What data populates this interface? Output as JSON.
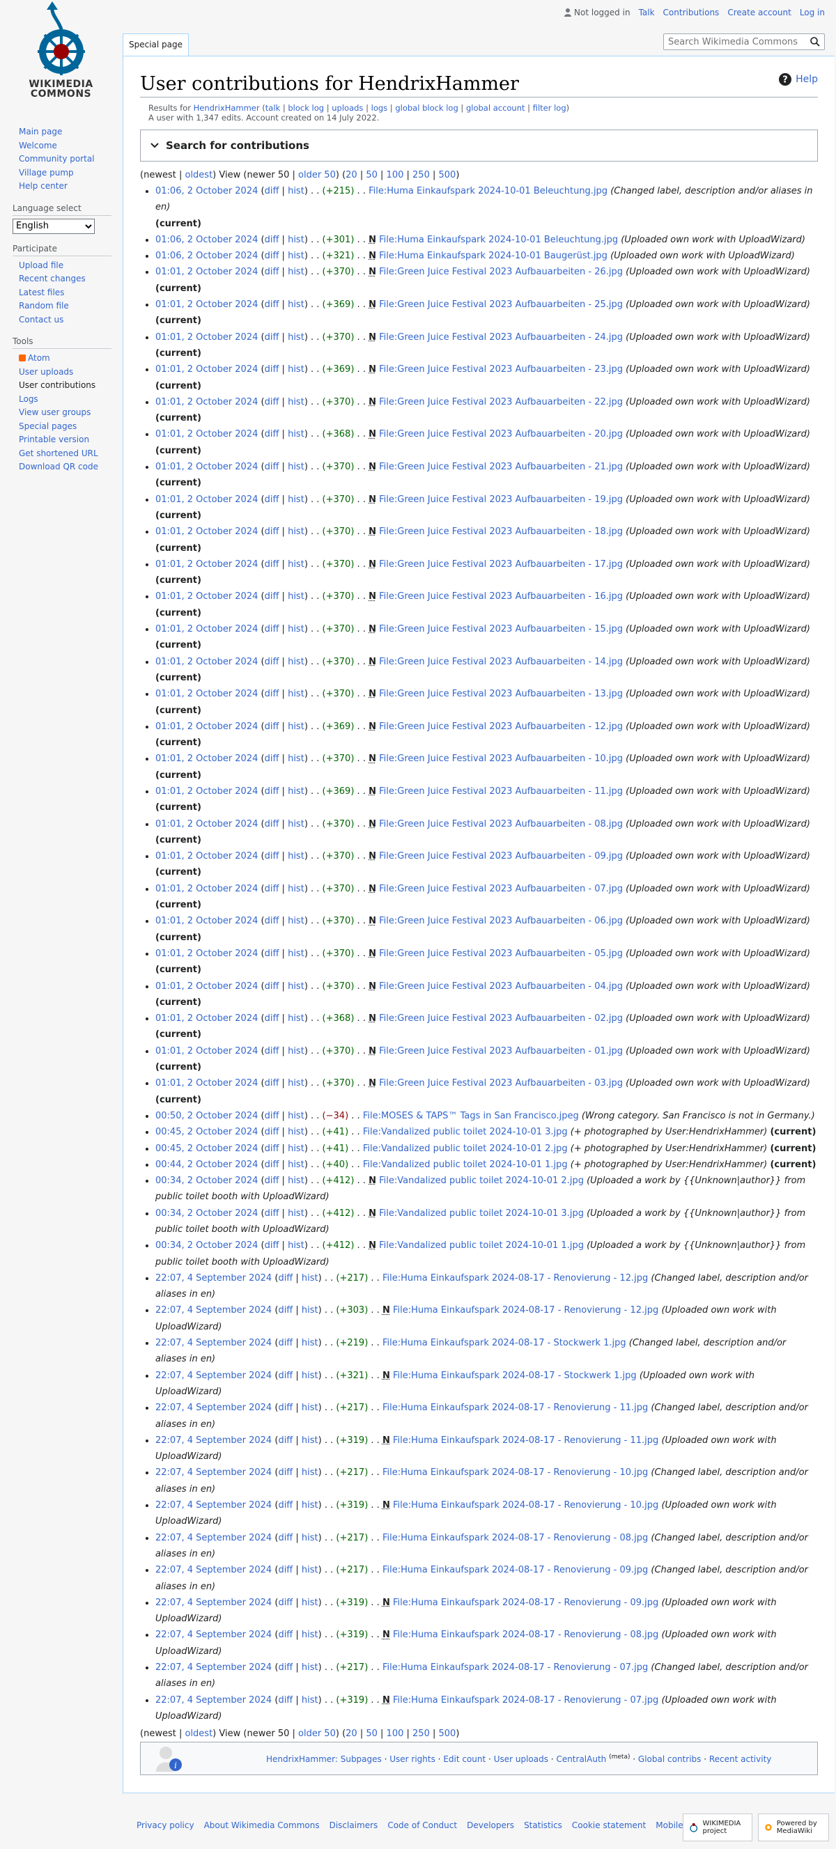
{
  "header": {
    "logo_alt": "Wikimedia Commons",
    "logo_line1": "WIKIMEDIA",
    "logo_line2": "COMMONS",
    "not_logged_in": "Not logged in",
    "talk": "Talk",
    "contributions": "Contributions",
    "create_account": "Create account",
    "log_in": "Log in",
    "tab_label": "Special page",
    "search_placeholder": "Search Wikimedia Commons"
  },
  "sidebar": {
    "nav": [
      "Main page",
      "Welcome",
      "Community portal",
      "Village pump",
      "Help center"
    ],
    "language_heading": "Language select",
    "language_value": "English",
    "participate_heading": "Participate",
    "participate": [
      "Upload file",
      "Recent changes",
      "Latest files",
      "Random file",
      "Contact us"
    ],
    "tools_heading": "Tools",
    "atom": "Atom",
    "tools": [
      "User uploads",
      "User contributions",
      "Logs",
      "View user groups",
      "Special pages",
      "Printable version",
      "Get shortened URL",
      "Download QR code"
    ]
  },
  "page": {
    "title": "User contributions for HendrixHammer",
    "help": "Help",
    "results_prefix": "Results for ",
    "user": "HendrixHammer",
    "user_links": [
      "talk",
      "block log",
      "uploads",
      "logs",
      "global block log",
      "global account",
      "filter log"
    ],
    "edit_info": "A user with 1,347 edits. Account created on 14 July 2022.",
    "search_toggle": "Search for contributions",
    "nav_newest": "newest",
    "nav_oldest": "oldest",
    "nav_view": "View",
    "nav_newer": "newer 50",
    "nav_older": "older 50",
    "nav_limits": [
      "20",
      "50",
      "100",
      "250",
      "500"
    ]
  },
  "contribs": [
    {
      "time": "01:06, 2 October 2024",
      "diff": "+215",
      "new": false,
      "title": "File:Huma Einkaufspark 2024-10-01 Beleuchtung.jpg",
      "comment": "(Changed label, description and/or aliases in en)",
      "current": true
    },
    {
      "time": "01:06, 2 October 2024",
      "diff": "+301",
      "new": true,
      "title": "File:Huma Einkaufspark 2024-10-01 Beleuchtung.jpg",
      "comment": "(Uploaded own work with UploadWizard)",
      "current": false
    },
    {
      "time": "01:06, 2 October 2024",
      "diff": "+321",
      "new": true,
      "title": "File:Huma Einkaufspark 2024-10-01 Baugerüst.jpg",
      "comment": "(Uploaded own work with UploadWizard)",
      "current": false
    },
    {
      "time": "01:01, 2 October 2024",
      "diff": "+370",
      "new": true,
      "title": "File:Green Juice Festival 2023 Aufbauarbeiten - 26.jpg",
      "comment": "(Uploaded own work with UploadWizard)",
      "current": true
    },
    {
      "time": "01:01, 2 October 2024",
      "diff": "+369",
      "new": true,
      "title": "File:Green Juice Festival 2023 Aufbauarbeiten - 25.jpg",
      "comment": "(Uploaded own work with UploadWizard)",
      "current": true
    },
    {
      "time": "01:01, 2 October 2024",
      "diff": "+370",
      "new": true,
      "title": "File:Green Juice Festival 2023 Aufbauarbeiten - 24.jpg",
      "comment": "(Uploaded own work with UploadWizard)",
      "current": true
    },
    {
      "time": "01:01, 2 October 2024",
      "diff": "+369",
      "new": true,
      "title": "File:Green Juice Festival 2023 Aufbauarbeiten - 23.jpg",
      "comment": "(Uploaded own work with UploadWizard)",
      "current": true
    },
    {
      "time": "01:01, 2 October 2024",
      "diff": "+370",
      "new": true,
      "title": "File:Green Juice Festival 2023 Aufbauarbeiten - 22.jpg",
      "comment": "(Uploaded own work with UploadWizard)",
      "current": true
    },
    {
      "time": "01:01, 2 October 2024",
      "diff": "+368",
      "new": true,
      "title": "File:Green Juice Festival 2023 Aufbauarbeiten - 20.jpg",
      "comment": "(Uploaded own work with UploadWizard)",
      "current": true
    },
    {
      "time": "01:01, 2 October 2024",
      "diff": "+370",
      "new": true,
      "title": "File:Green Juice Festival 2023 Aufbauarbeiten - 21.jpg",
      "comment": "(Uploaded own work with UploadWizard)",
      "current": true
    },
    {
      "time": "01:01, 2 October 2024",
      "diff": "+370",
      "new": true,
      "title": "File:Green Juice Festival 2023 Aufbauarbeiten - 19.jpg",
      "comment": "(Uploaded own work with UploadWizard)",
      "current": true
    },
    {
      "time": "01:01, 2 October 2024",
      "diff": "+370",
      "new": true,
      "title": "File:Green Juice Festival 2023 Aufbauarbeiten - 18.jpg",
      "comment": "(Uploaded own work with UploadWizard)",
      "current": true
    },
    {
      "time": "01:01, 2 October 2024",
      "diff": "+370",
      "new": true,
      "title": "File:Green Juice Festival 2023 Aufbauarbeiten - 17.jpg",
      "comment": "(Uploaded own work with UploadWizard)",
      "current": true
    },
    {
      "time": "01:01, 2 October 2024",
      "diff": "+370",
      "new": true,
      "title": "File:Green Juice Festival 2023 Aufbauarbeiten - 16.jpg",
      "comment": "(Uploaded own work with UploadWizard)",
      "current": true
    },
    {
      "time": "01:01, 2 October 2024",
      "diff": "+370",
      "new": true,
      "title": "File:Green Juice Festival 2023 Aufbauarbeiten - 15.jpg",
      "comment": "(Uploaded own work with UploadWizard)",
      "current": true
    },
    {
      "time": "01:01, 2 October 2024",
      "diff": "+370",
      "new": true,
      "title": "File:Green Juice Festival 2023 Aufbauarbeiten - 14.jpg",
      "comment": "(Uploaded own work with UploadWizard)",
      "current": true
    },
    {
      "time": "01:01, 2 October 2024",
      "diff": "+370",
      "new": true,
      "title": "File:Green Juice Festival 2023 Aufbauarbeiten - 13.jpg",
      "comment": "(Uploaded own work with UploadWizard)",
      "current": true
    },
    {
      "time": "01:01, 2 October 2024",
      "diff": "+369",
      "new": true,
      "title": "File:Green Juice Festival 2023 Aufbauarbeiten - 12.jpg",
      "comment": "(Uploaded own work with UploadWizard)",
      "current": true
    },
    {
      "time": "01:01, 2 October 2024",
      "diff": "+370",
      "new": true,
      "title": "File:Green Juice Festival 2023 Aufbauarbeiten - 10.jpg",
      "comment": "(Uploaded own work with UploadWizard)",
      "current": true
    },
    {
      "time": "01:01, 2 October 2024",
      "diff": "+369",
      "new": true,
      "title": "File:Green Juice Festival 2023 Aufbauarbeiten - 11.jpg",
      "comment": "(Uploaded own work with UploadWizard)",
      "current": true
    },
    {
      "time": "01:01, 2 October 2024",
      "diff": "+370",
      "new": true,
      "title": "File:Green Juice Festival 2023 Aufbauarbeiten - 08.jpg",
      "comment": "(Uploaded own work with UploadWizard)",
      "current": true
    },
    {
      "time": "01:01, 2 October 2024",
      "diff": "+370",
      "new": true,
      "title": "File:Green Juice Festival 2023 Aufbauarbeiten - 09.jpg",
      "comment": "(Uploaded own work with UploadWizard)",
      "current": true
    },
    {
      "time": "01:01, 2 October 2024",
      "diff": "+370",
      "new": true,
      "title": "File:Green Juice Festival 2023 Aufbauarbeiten - 07.jpg",
      "comment": "(Uploaded own work with UploadWizard)",
      "current": true
    },
    {
      "time": "01:01, 2 October 2024",
      "diff": "+370",
      "new": true,
      "title": "File:Green Juice Festival 2023 Aufbauarbeiten - 06.jpg",
      "comment": "(Uploaded own work with UploadWizard)",
      "current": true
    },
    {
      "time": "01:01, 2 October 2024",
      "diff": "+370",
      "new": true,
      "title": "File:Green Juice Festival 2023 Aufbauarbeiten - 05.jpg",
      "comment": "(Uploaded own work with UploadWizard)",
      "current": true
    },
    {
      "time": "01:01, 2 October 2024",
      "diff": "+370",
      "new": true,
      "title": "File:Green Juice Festival 2023 Aufbauarbeiten - 04.jpg",
      "comment": "(Uploaded own work with UploadWizard)",
      "current": true
    },
    {
      "time": "01:01, 2 October 2024",
      "diff": "+368",
      "new": true,
      "title": "File:Green Juice Festival 2023 Aufbauarbeiten - 02.jpg",
      "comment": "(Uploaded own work with UploadWizard)",
      "current": true
    },
    {
      "time": "01:01, 2 October 2024",
      "diff": "+370",
      "new": true,
      "title": "File:Green Juice Festival 2023 Aufbauarbeiten - 01.jpg",
      "comment": "(Uploaded own work with UploadWizard)",
      "current": true
    },
    {
      "time": "01:01, 2 October 2024",
      "diff": "+370",
      "new": true,
      "title": "File:Green Juice Festival 2023 Aufbauarbeiten - 03.jpg",
      "comment": "(Uploaded own work with UploadWizard)",
      "current": true
    },
    {
      "time": "00:50, 2 October 2024",
      "diff": "−34",
      "new": false,
      "title": "File:MOSES & TAPS™ Tags in San Francisco.jpeg",
      "comment": "(Wrong category. San Francisco is not in Germany.)",
      "current": false
    },
    {
      "time": "00:45, 2 October 2024",
      "diff": "+41",
      "new": false,
      "title": "File:Vandalized public toilet 2024-10-01 3.jpg",
      "comment": "(+ photographed by User:HendrixHammer)",
      "current": true
    },
    {
      "time": "00:45, 2 October 2024",
      "diff": "+41",
      "new": false,
      "title": "File:Vandalized public toilet 2024-10-01 2.jpg",
      "comment": "(+ photographed by User:HendrixHammer)",
      "current": true
    },
    {
      "time": "00:44, 2 October 2024",
      "diff": "+40",
      "new": false,
      "title": "File:Vandalized public toilet 2024-10-01 1.jpg",
      "comment": "(+ photographed by User:HendrixHammer)",
      "current": true
    },
    {
      "time": "00:34, 2 October 2024",
      "diff": "+412",
      "new": true,
      "title": "File:Vandalized public toilet 2024-10-01 2.jpg",
      "comment": "(Uploaded a work by {{Unknown|author}} from public toilet booth with UploadWizard)",
      "current": false
    },
    {
      "time": "00:34, 2 October 2024",
      "diff": "+412",
      "new": true,
      "title": "File:Vandalized public toilet 2024-10-01 3.jpg",
      "comment": "(Uploaded a work by {{Unknown|author}} from public toilet booth with UploadWizard)",
      "current": false
    },
    {
      "time": "00:34, 2 October 2024",
      "diff": "+412",
      "new": true,
      "title": "File:Vandalized public toilet 2024-10-01 1.jpg",
      "comment": "(Uploaded a work by {{Unknown|author}} from public toilet booth with UploadWizard)",
      "current": false
    },
    {
      "time": "22:07, 4 September 2024",
      "diff": "+217",
      "new": false,
      "title": "File:Huma Einkaufspark 2024-08-17 - Renovierung - 12.jpg",
      "comment": "(Changed label, description and/or aliases in en)",
      "current": false
    },
    {
      "time": "22:07, 4 September 2024",
      "diff": "+303",
      "new": true,
      "title": "File:Huma Einkaufspark 2024-08-17 - Renovierung - 12.jpg",
      "comment": "(Uploaded own work with UploadWizard)",
      "current": false
    },
    {
      "time": "22:07, 4 September 2024",
      "diff": "+219",
      "new": false,
      "title": "File:Huma Einkaufspark 2024-08-17 - Stockwerk 1.jpg",
      "comment": "(Changed label, description and/or aliases in en)",
      "current": false
    },
    {
      "time": "22:07, 4 September 2024",
      "diff": "+321",
      "new": true,
      "title": "File:Huma Einkaufspark 2024-08-17 - Stockwerk 1.jpg",
      "comment": "(Uploaded own work with UploadWizard)",
      "current": false
    },
    {
      "time": "22:07, 4 September 2024",
      "diff": "+217",
      "new": false,
      "title": "File:Huma Einkaufspark 2024-08-17 - Renovierung - 11.jpg",
      "comment": "(Changed label, description and/or aliases in en)",
      "current": false
    },
    {
      "time": "22:07, 4 September 2024",
      "diff": "+319",
      "new": true,
      "title": "File:Huma Einkaufspark 2024-08-17 - Renovierung - 11.jpg",
      "comment": "(Uploaded own work with UploadWizard)",
      "current": false
    },
    {
      "time": "22:07, 4 September 2024",
      "diff": "+217",
      "new": false,
      "title": "File:Huma Einkaufspark 2024-08-17 - Renovierung - 10.jpg",
      "comment": "(Changed label, description and/or aliases in en)",
      "current": false
    },
    {
      "time": "22:07, 4 September 2024",
      "diff": "+319",
      "new": true,
      "title": "File:Huma Einkaufspark 2024-08-17 - Renovierung - 10.jpg",
      "comment": "(Uploaded own work with UploadWizard)",
      "current": false
    },
    {
      "time": "22:07, 4 September 2024",
      "diff": "+217",
      "new": false,
      "title": "File:Huma Einkaufspark 2024-08-17 - Renovierung - 08.jpg",
      "comment": "(Changed label, description and/or aliases in en)",
      "current": false
    },
    {
      "time": "22:07, 4 September 2024",
      "diff": "+217",
      "new": false,
      "title": "File:Huma Einkaufspark 2024-08-17 - Renovierung - 09.jpg",
      "comment": "(Changed label, description and/or aliases in en)",
      "current": false
    },
    {
      "time": "22:07, 4 September 2024",
      "diff": "+319",
      "new": true,
      "title": "File:Huma Einkaufspark 2024-08-17 - Renovierung - 09.jpg",
      "comment": "(Uploaded own work with UploadWizard)",
      "current": false
    },
    {
      "time": "22:07, 4 September 2024",
      "diff": "+319",
      "new": true,
      "title": "File:Huma Einkaufspark 2024-08-17 - Renovierung - 08.jpg",
      "comment": "(Uploaded own work with UploadWizard)",
      "current": false
    },
    {
      "time": "22:07, 4 September 2024",
      "diff": "+217",
      "new": false,
      "title": "File:Huma Einkaufspark 2024-08-17 - Renovierung - 07.jpg",
      "comment": "(Changed label, description and/or aliases in en)",
      "current": false
    },
    {
      "time": "22:07, 4 September 2024",
      "diff": "+319",
      "new": true,
      "title": "File:Huma Einkaufspark 2024-08-17 - Renovierung - 07.jpg",
      "comment": "(Uploaded own work with UploadWizard)",
      "current": false
    }
  ],
  "labels": {
    "diff": "diff",
    "hist": "hist",
    "new_flag": "N",
    "current": "(current)"
  },
  "userbox": {
    "subpages": "HendrixHammer: Subpages",
    "links": [
      "User rights",
      "Edit count",
      "User uploads",
      "CentralAuth",
      "Global contribs",
      "Recent activity"
    ],
    "meta": "(meta)"
  },
  "footer": {
    "links": [
      "Privacy policy",
      "About Wikimedia Commons",
      "Disclaimers",
      "Code of Conduct",
      "Developers",
      "Statistics",
      "Cookie statement",
      "Mobile view"
    ],
    "wikimedia_badge": "WIKIMEDIA project",
    "mediawiki_badge": "Powered by MediaWiki"
  },
  "colors": {
    "link": "#3366cc",
    "positive": "#006400",
    "negative": "#8b0000",
    "border": "#a7d7f9"
  }
}
